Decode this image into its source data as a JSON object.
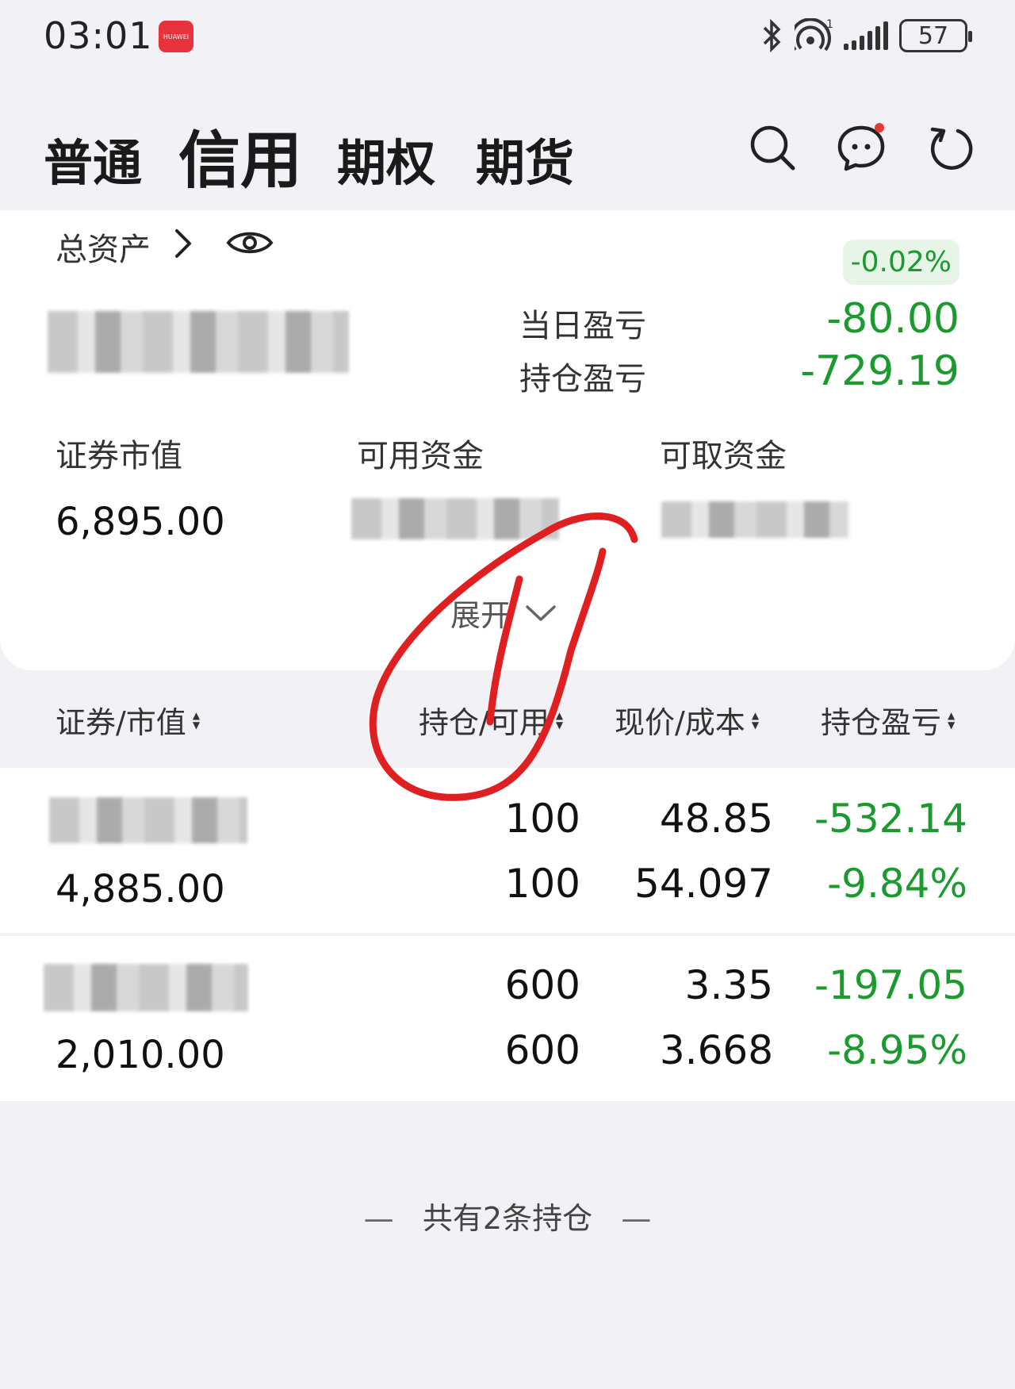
{
  "status_bar": {
    "time": "03:01",
    "app_badge": "HUAWEI",
    "battery": "57",
    "icons": [
      "bluetooth-icon",
      "hotspot-icon",
      "signal-icon",
      "battery-icon"
    ]
  },
  "tabs": [
    {
      "label": "普通",
      "active": false
    },
    {
      "label": "信用",
      "active": true
    },
    {
      "label": "期权",
      "active": false
    },
    {
      "label": "期货",
      "active": false
    }
  ],
  "header_icons": [
    "search-icon",
    "message-icon",
    "refresh-icon"
  ],
  "account": {
    "total_assets_label": "总资产",
    "change_pct": "-0.02%",
    "daily_pl_label": "当日盈亏",
    "daily_pl": "-80.00",
    "position_pl_label": "持仓盈亏",
    "position_pl": "-729.19",
    "market_value_label": "证券市值",
    "market_value": "6,895.00",
    "available_funds_label": "可用资金",
    "withdrawable_funds_label": "可取资金",
    "expand_label": "展开"
  },
  "positions_header": {
    "col1": "证券/市值",
    "col2": "持仓/可用",
    "col3": "现价/成本",
    "col4": "持仓盈亏"
  },
  "positions": [
    {
      "market_value": "4,885.00",
      "holding": "100",
      "available": "100",
      "price": "48.85",
      "cost": "54.097",
      "pl": "-532.14",
      "pl_pct": "-9.84%"
    },
    {
      "market_value": "2,010.00",
      "holding": "600",
      "available": "600",
      "price": "3.35",
      "cost": "3.668",
      "pl": "-197.05",
      "pl_pct": "-8.95%"
    }
  ],
  "footer": {
    "text": "共有2条持仓"
  },
  "colors": {
    "loss_green": "#1b9a2e",
    "badge_bg": "#e6f5e8",
    "annotation_red": "#e02020"
  }
}
